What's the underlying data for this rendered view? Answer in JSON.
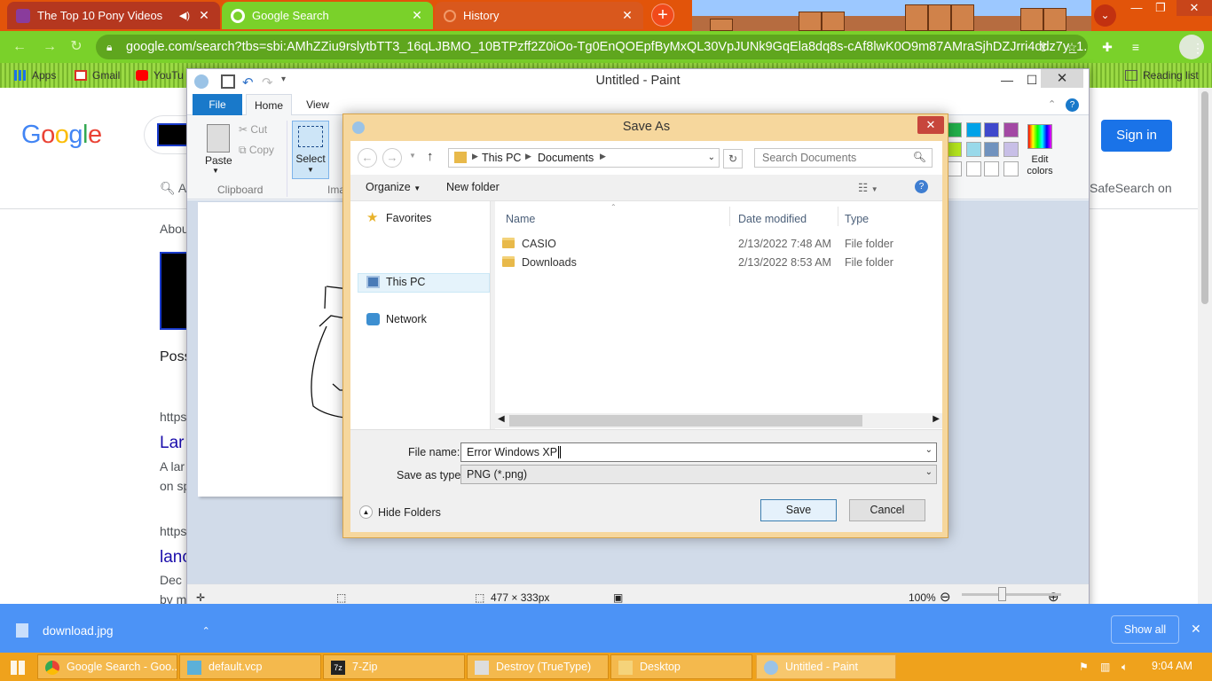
{
  "browser": {
    "tabs": [
      {
        "title": "The Top 10 Pony Videos",
        "icon": "pony-favicon"
      },
      {
        "title": "Google Search",
        "icon": "google-favicon"
      },
      {
        "title": "History",
        "icon": "history-icon"
      }
    ],
    "url": "google.com/search?tbs=sbi:AMhZZiu9rslytbTT3_16qLJBMO_10BTPzff2Z0iOo-Tg0EnQOEpfByMxQL30VpJUNk9GqEla8dq8s-cAf8lwK0O9m87AMraSjhDZJrri4ddz7y_1...",
    "bookmarks": [
      "Apps",
      "Gmail",
      "YouTu"
    ],
    "reading_list": "Reading list",
    "theme_colors": {
      "tabstrip": "#e2540a",
      "toolbar": "#7ad12a"
    }
  },
  "google": {
    "logo": "Google",
    "sign_in": "Sign in",
    "tabs_label": "A",
    "safesearch": "SafeSearch on",
    "about": "Abou",
    "possible": "Poss",
    "results": [
      {
        "url": "https",
        "title": "Lar",
        "line1": "A lar",
        "line2": "on sp"
      },
      {
        "url": "https",
        "title": "lanc",
        "line1": "Dec",
        "line2": "by m"
      }
    ]
  },
  "paint": {
    "title": "Untitled - Paint",
    "ribbon_tabs": [
      "File",
      "Home",
      "View"
    ],
    "paste": "Paste",
    "cut": "Cut",
    "copy": "Copy",
    "clipboard": "Clipboard",
    "select": "Select",
    "image_group": "Ima",
    "edit_colors": "Edit colors",
    "status_size": "477 × 333px",
    "zoom": "100%",
    "swatches": [
      "#22b14c",
      "#00a2e8",
      "#3f48cc",
      "#a349a4",
      "#b5e61d",
      "#99d9ea",
      "#7092be",
      "#c8bfe7"
    ]
  },
  "dialog": {
    "title": "Save As",
    "path": [
      "This PC",
      "Documents"
    ],
    "search_placeholder": "Search Documents",
    "organize": "Organize",
    "new_folder": "New folder",
    "nav": {
      "favorites": "Favorites",
      "this_pc": "This PC",
      "network": "Network"
    },
    "columns": {
      "name": "Name",
      "date": "Date modified",
      "type": "Type"
    },
    "files": [
      {
        "name": "CASIO",
        "date": "2/13/2022 7:48 AM",
        "type": "File folder"
      },
      {
        "name": "Downloads",
        "date": "2/13/2022 8:53 AM",
        "type": "File folder"
      }
    ],
    "file_name_label": "File name:",
    "file_name": "Error Windows XP",
    "save_type_label": "Save as type:",
    "save_type": "PNG (*.png)",
    "hide_folders": "Hide Folders",
    "save": "Save",
    "cancel": "Cancel"
  },
  "downloads": {
    "file": "download.jpg",
    "show_all": "Show all"
  },
  "taskbar": {
    "items": [
      "Google Search - Goo...",
      "default.vcp",
      "7-Zip",
      "Destroy (TrueType)",
      "Desktop",
      "Untitled - Paint"
    ],
    "clock": "9:04 AM"
  }
}
